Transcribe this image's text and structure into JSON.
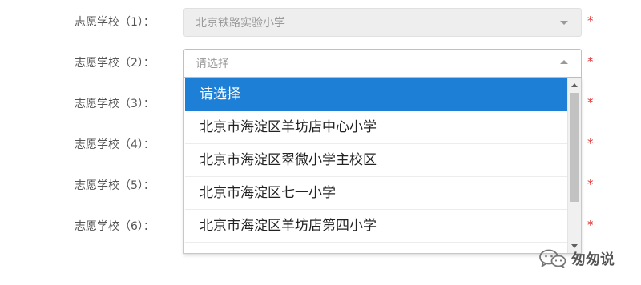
{
  "form": {
    "rows": [
      {
        "label": "志愿学校（1）：",
        "value": "北京铁路实验小学"
      },
      {
        "label": "志愿学校（2）：",
        "value": "请选择"
      },
      {
        "label": "志愿学校（3）："
      },
      {
        "label": "志愿学校（4）："
      },
      {
        "label": "志愿学校（5）："
      },
      {
        "label": "志愿学校（6）："
      }
    ],
    "required_mark": "*"
  },
  "dropdown": {
    "options": [
      "请选择",
      "北京市海淀区羊坊店中心小学",
      "北京市海淀区翠微小学主校区",
      "北京市海淀区七一小学",
      "北京市海淀区羊坊店第四小学"
    ],
    "highlighted_index": 0
  },
  "watermark": {
    "text": "匆匆说",
    "icon": "wechat-logo-icon"
  },
  "colors": {
    "highlight": "#1e7fd6",
    "required": "#e03030",
    "active_border": "#e8aeb0"
  }
}
